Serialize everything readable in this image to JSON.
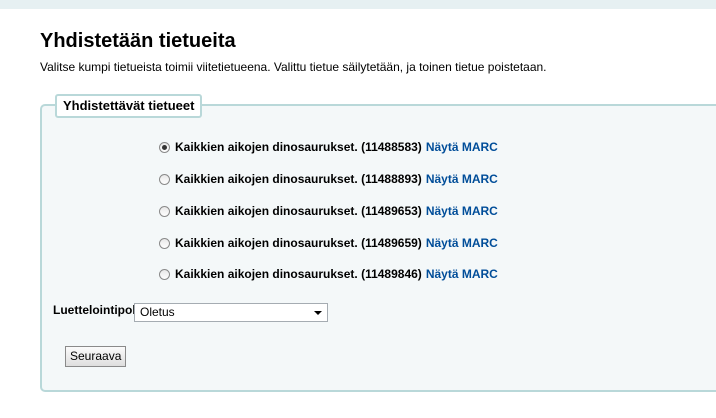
{
  "page": {
    "title": "Yhdistetään tietueita",
    "intro": "Valitse kumpi tietueista toimii viitetietueena. Valittu tietue säilytetään, ja toinen tietue poistetaan."
  },
  "records_section": {
    "legend": "Yhdistettävät tietueet",
    "records": [
      {
        "title": "Kaikkien aikojen dinosaurukset.",
        "id": "(11488583)",
        "link": "Näytä MARC",
        "selected": true
      },
      {
        "title": "Kaikkien aikojen dinosaurukset.",
        "id": "(11488893)",
        "link": "Näytä MARC",
        "selected": false
      },
      {
        "title": "Kaikkien aikojen dinosaurukset.",
        "id": "(11489653)",
        "link": "Näytä MARC",
        "selected": false
      },
      {
        "title": "Kaikkien aikojen dinosaurukset.",
        "id": "(11489659)",
        "link": "Näytä MARC",
        "selected": false
      },
      {
        "title": "Kaikkien aikojen dinosaurukset.",
        "id": "(11489846)",
        "link": "Näytä MARC",
        "selected": false
      }
    ]
  },
  "framework": {
    "label": "Luettelointipohja",
    "selected": "Oletus"
  },
  "actions": {
    "next_label": "Seuraava"
  },
  "colors": {
    "link": "#004d99",
    "fieldset_border": "#b9d8d9",
    "fieldset_background": "#f4f8f9"
  }
}
